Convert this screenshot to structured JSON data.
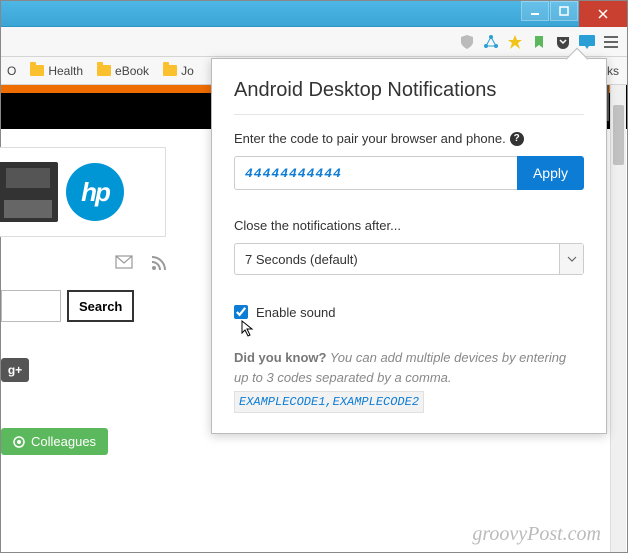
{
  "bookmarks": {
    "item0": "O",
    "item1": "Health",
    "item2": "eBook",
    "item3": "Jo",
    "overflow": "narks"
  },
  "page": {
    "hp_text": "hp",
    "search_label": "Search",
    "gplus": "g+",
    "colleagues": "Colleagues"
  },
  "popup": {
    "title": "Android Desktop Notifications",
    "pair_label": "Enter the code to pair your browser and phone.",
    "code_value": "44444444444",
    "apply": "Apply",
    "close_label": "Close the notifications after...",
    "duration": "7 Seconds (default)",
    "enable_sound": "Enable sound",
    "tip_lead": "Did you know?",
    "tip_body": "You can add multiple devices by entering up to 3 codes separated by a comma.",
    "example": "EXAMPLECODE1,EXAMPLECODE2"
  },
  "watermark": "groovyPost.com"
}
